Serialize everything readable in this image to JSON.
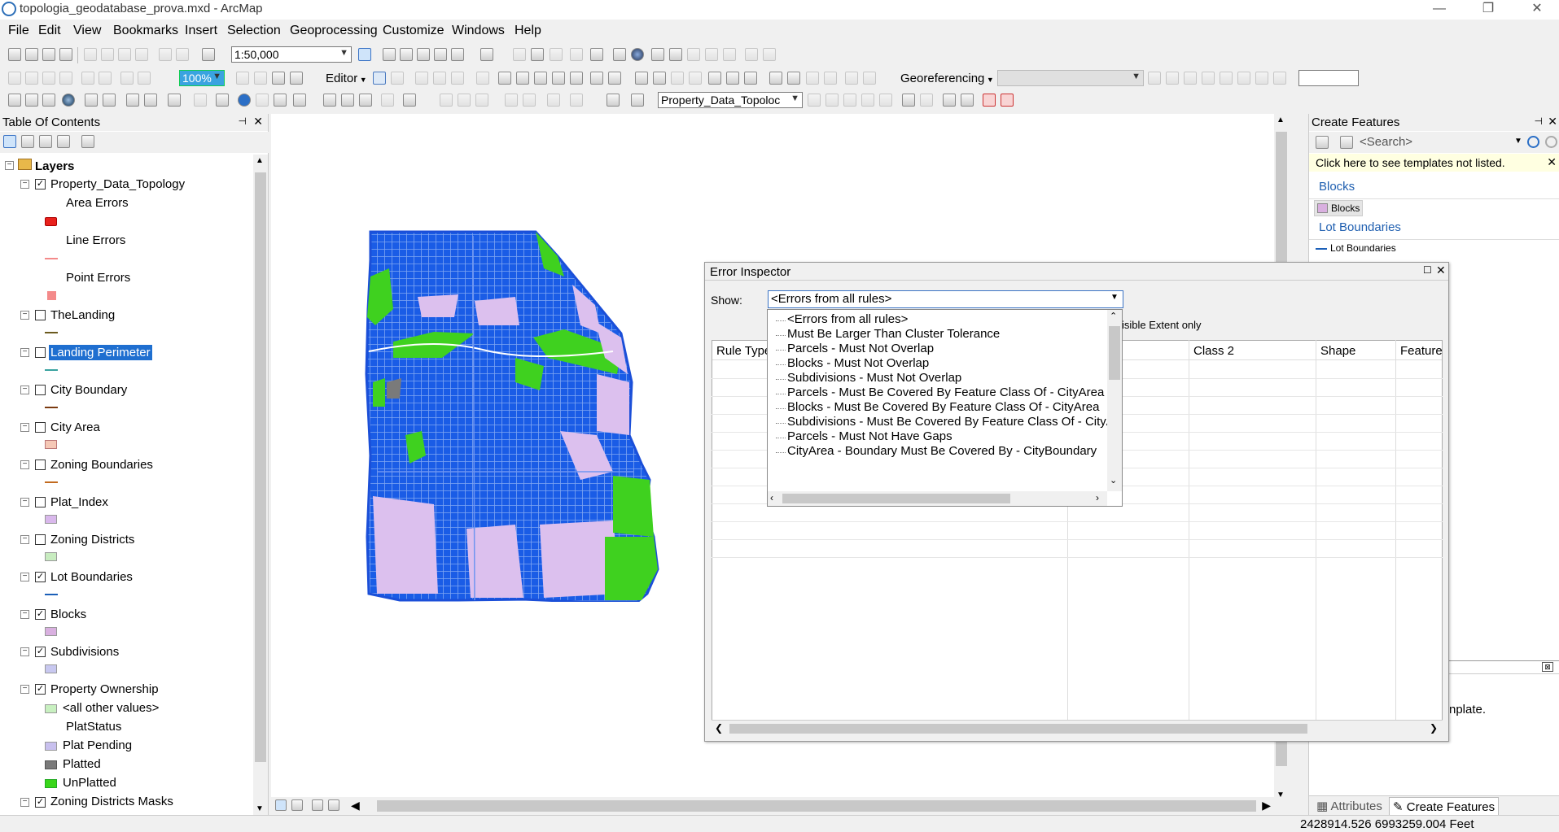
{
  "window": {
    "title": "topologia_geodatabase_prova.mxd - ArcMap",
    "min_glyph": "—",
    "max_glyph": "❐",
    "close_glyph": "✕"
  },
  "menu": [
    "File",
    "Edit",
    "View",
    "Bookmarks",
    "Insert",
    "Selection",
    "Geoprocessing",
    "Customize",
    "Windows",
    "Help"
  ],
  "toolbar": {
    "scale": "1:50,000",
    "editor_label": "Editor",
    "georef_label": "Georeferencing",
    "topology_combo": "Property_Data_Topoloc",
    "zoom_field": "100%"
  },
  "toc": {
    "title": "Table Of Contents",
    "pin_glyph": "⊣",
    "close_glyph": "✕",
    "root": "Layers",
    "layers": [
      {
        "label": "Property_Data_Topology",
        "checked": true
      },
      {
        "label": "Area Errors"
      },
      {
        "label": "Line Errors"
      },
      {
        "label": "Point Errors"
      },
      {
        "label": "TheLanding",
        "checked": false
      },
      {
        "label": "Landing Perimeter",
        "checked": false
      },
      {
        "label": "City Boundary",
        "checked": false
      },
      {
        "label": "City Area",
        "checked": false
      },
      {
        "label": "Zoning Boundaries",
        "checked": false
      },
      {
        "label": "Plat_Index",
        "checked": false
      },
      {
        "label": "Zoning Districts",
        "checked": false
      },
      {
        "label": "Lot Boundaries",
        "checked": true
      },
      {
        "label": "Blocks",
        "checked": true
      },
      {
        "label": "Subdivisions",
        "checked": true
      },
      {
        "label": "Property Ownership",
        "checked": true
      },
      {
        "label": "<all other values>"
      },
      {
        "label": "PlatStatus"
      },
      {
        "label": "Plat Pending"
      },
      {
        "label": "Platted"
      },
      {
        "label": "UnPlatted"
      },
      {
        "label": "Zoning Districts Masks",
        "checked": true
      }
    ],
    "colors": {
      "area_error": "#e8211c",
      "line_error": "#f48a8a",
      "point_error": "#f48a8a",
      "the_landing": "#6b5a1e",
      "landing_perimeter": "#3aa3a0",
      "city_boundary": "#7a3a10",
      "city_area": "#f5c8b6",
      "zoning_boundaries": "#c26a1e",
      "plat_index": "#d9b8ec",
      "zoning_districts": "#c8ecc0",
      "lot_boundaries": "#1b5fb8",
      "blocks": "#d9b0e0",
      "subdivisions": "#c8c8f0",
      "other_values": "#c8f0c0",
      "plat_pending": "#c8c0ee",
      "platted": "#7a7a7a",
      "unplatted": "#39d61a"
    }
  },
  "create_features": {
    "title": "Create Features",
    "search_placeholder": "<Search>",
    "notice": "Click here to see templates not listed.",
    "groups": [
      {
        "group": "Blocks",
        "item": "Blocks"
      },
      {
        "group": "Lot Boundaries",
        "item": "Lot Boundaries"
      }
    ],
    "bottom_text": "nplate.",
    "tab_attributes": "Attributes",
    "tab_create": "Create Features"
  },
  "error_inspector": {
    "title": "Error Inspector",
    "show_label": "Show:",
    "show_value": "<Errors from all rules>",
    "visible_extent_text": "isible Extent only",
    "columns": [
      "Rule Type",
      "Class 2",
      "Shape",
      "Feature"
    ],
    "options": [
      "<Errors from all rules>",
      "Must Be Larger Than Cluster Tolerance",
      "Parcels - Must Not Overlap",
      "Blocks - Must Not Overlap",
      "Subdivisions - Must Not Overlap",
      "Parcels - Must Be Covered By Feature Class Of - CityArea",
      "Blocks - Must Be Covered By Feature Class Of - CityArea",
      "Subdivisions - Must Be Covered By Feature Class Of - CityAr",
      "Parcels - Must Not Have Gaps",
      "CityArea - Boundary Must Be Covered By - CityBoundary"
    ]
  },
  "map_colors": {
    "parcel_blue": "#1a5ce6",
    "unplatted_green": "#3fd11f",
    "subdivision_pink": "#dcc0ee"
  },
  "status": {
    "coordinates": "2428914.526  6993259.004 Feet"
  }
}
